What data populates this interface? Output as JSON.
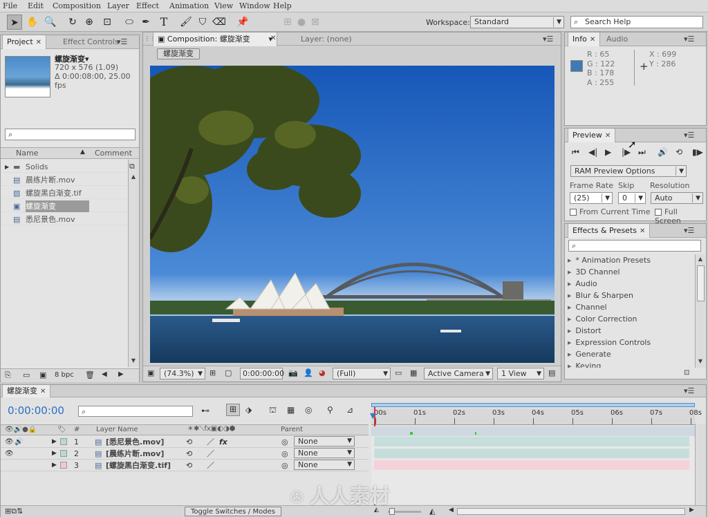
{
  "menu": [
    "File",
    "Edit",
    "Composition",
    "Layer",
    "Effect",
    "Animation",
    "View",
    "Window",
    "Help"
  ],
  "toolbar": {
    "workspace_label": "Workspace:",
    "workspace_value": "Standard",
    "search_placeholder": "Search Help"
  },
  "project": {
    "tabs": {
      "project": "Project",
      "effect_controls": "Effect Controls"
    },
    "item_name": "螺旋渐变▾",
    "item_dims": "720 x 576 (1.09)",
    "item_duration": "Δ 0:00:08:00, 25.00 fps",
    "col_name": "Name",
    "col_comment": "Comment",
    "items": [
      {
        "label": "Solids",
        "kind": "folder"
      },
      {
        "label": "晨练片断.mov",
        "kind": "movie"
      },
      {
        "label": "螺旋黑白渐变.tif",
        "kind": "image"
      },
      {
        "label": "螺旋渐变",
        "kind": "comp",
        "selected": true
      },
      {
        "label": "悉尼景色.mov",
        "kind": "movie"
      }
    ],
    "bpc": "8 bpc"
  },
  "composition": {
    "tab_label": "Composition: 螺旋渐变",
    "layer_tab": "Layer: (none)",
    "comp_button": "螺旋渐变",
    "zoom": "(74.3%)",
    "timecode": "0:00:00:00",
    "resolution": "(Full)",
    "camera": "Active Camera",
    "views": "1 View"
  },
  "info": {
    "tabs": {
      "info": "Info",
      "audio": "Audio"
    },
    "r": "R : 65",
    "g": "G : 122",
    "b": "B : 178",
    "a": "A : 255",
    "x": "X : 699",
    "y": "Y : 286",
    "swatch_color": "#4179b2"
  },
  "preview": {
    "tab": "Preview",
    "ram_options": "RAM Preview Options",
    "frame_rate_label": "Frame Rate",
    "skip_label": "Skip",
    "resolution_label": "Resolution",
    "frame_rate": "(25)",
    "skip": "0",
    "resolution": "Auto",
    "from_current": "From Current Time",
    "full_screen": "Full Screen"
  },
  "effects": {
    "tab": "Effects & Presets",
    "items": [
      "* Animation Presets",
      "3D Channel",
      "Audio",
      "Blur & Sharpen",
      "Channel",
      "Color Correction",
      "Distort",
      "Expression Controls",
      "Generate",
      "Keying"
    ]
  },
  "timeline": {
    "tab": "螺旋渐变",
    "timecode": "0:00:00:00",
    "col_num": "#",
    "col_layer": "Layer Name",
    "col_parent": "Parent",
    "ruler": [
      "00s",
      "01s",
      "02s",
      "03s",
      "04s",
      "05s",
      "06s",
      "07s",
      "08s"
    ],
    "layers": [
      {
        "num": "1",
        "name": "[悉尼景色.mov]",
        "color": "#b8d8d4",
        "bar": "#c5dedc",
        "parent": "None",
        "fx": "fx"
      },
      {
        "num": "2",
        "name": "[晨练片断.mov]",
        "color": "#b8d8d4",
        "bar": "#c5dedc",
        "parent": "None",
        "fx": ""
      },
      {
        "num": "3",
        "name": "[螺旋黑白渐变.tif]",
        "color": "#f0c8d0",
        "bar": "#f5d2da",
        "parent": "None",
        "fx": ""
      }
    ],
    "toggle": "Toggle Switches / Modes"
  },
  "watermark": "人人素材"
}
